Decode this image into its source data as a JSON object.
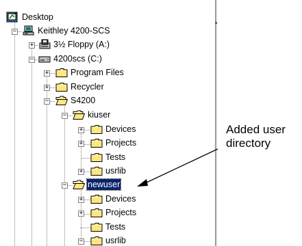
{
  "tree": {
    "desktop": {
      "label": "Desktop",
      "icon": "desktop-icon"
    },
    "computer": {
      "label": "Keithley 4200-SCS",
      "icon": "computer-icon",
      "expander": "−"
    },
    "floppy": {
      "label": "3½ Floppy (A:)",
      "icon": "floppy-drive-icon",
      "expander": "+"
    },
    "drive_c": {
      "label": "4200scs (C:)",
      "icon": "hard-drive-icon",
      "expander": "−"
    },
    "program_files": {
      "label": "Program Files",
      "icon": "folder-icon",
      "expander": "+"
    },
    "recycler": {
      "label": "Recycler",
      "icon": "folder-icon",
      "expander": "+"
    },
    "s4200": {
      "label": "S4200",
      "icon": "open-folder-icon",
      "expander": "−"
    },
    "kiuser": {
      "label": "kiuser",
      "icon": "open-folder-icon",
      "expander": "−"
    },
    "kiuser_devices": {
      "label": "Devices",
      "icon": "folder-icon",
      "expander": "+"
    },
    "kiuser_projects": {
      "label": "Projects",
      "icon": "folder-icon",
      "expander": "+"
    },
    "kiuser_tests": {
      "label": "Tests",
      "icon": "folder-icon"
    },
    "kiuser_usrlib": {
      "label": "usrlib",
      "icon": "folder-icon",
      "expander": "+"
    },
    "newuser": {
      "label": "newuser",
      "icon": "open-folder-icon",
      "expander": "−",
      "selected": true
    },
    "newuser_devices": {
      "label": "Devices",
      "icon": "folder-icon",
      "expander": "+"
    },
    "newuser_projects": {
      "label": "Projects",
      "icon": "folder-icon",
      "expander": "+"
    },
    "newuser_tests": {
      "label": "Tests",
      "icon": "folder-icon"
    },
    "newuser_usrlib": {
      "label": "usrlib",
      "icon": "folder-icon",
      "expander": "−"
    }
  },
  "callout": {
    "line1": "Added user",
    "line2": "directory"
  },
  "colors": {
    "selection": "#0a246a",
    "folder_yellow": "#ffe680",
    "tree_lines": "#808080"
  }
}
